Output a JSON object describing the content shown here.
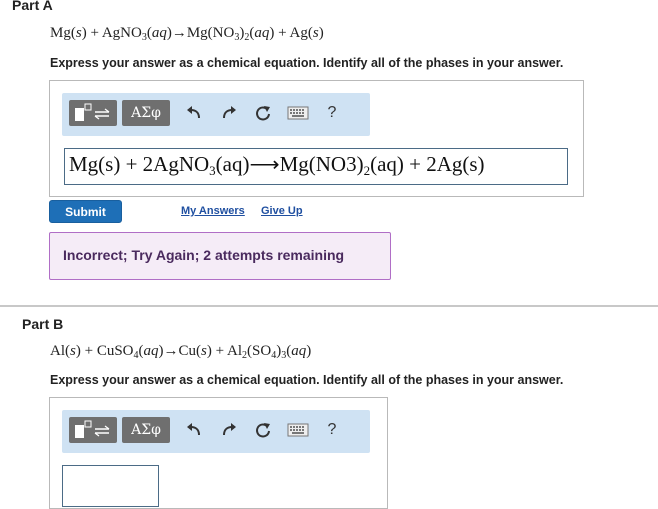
{
  "part_a": {
    "title": "Part A",
    "equation": {
      "r1": "Mg",
      "r1_phase": "s",
      "plus1": "+",
      "r2_a": "AgNO",
      "r2_sub": "3",
      "r2_phase": "aq",
      "arrow": "→",
      "p1_a": "Mg(NO",
      "p1_sub1": "3",
      "p1_close": ")",
      "p1_sub2": "2",
      "p1_phase": "aq",
      "plus2": "+",
      "p2": "Ag",
      "p2_phase": "s"
    },
    "instruction": "Express your answer as a chemical equation. Identify all of the phases in your answer.",
    "toolbar": {
      "symbols_label": "ΑΣφ",
      "help_label": "?"
    },
    "answer": {
      "part1": "Mg(s) + 2AgNO",
      "sub1": "3",
      "part2": "(aq)⟶Mg(NO3)",
      "sub2": "2",
      "part3": "(aq) + 2Ag(s)"
    },
    "submit_label": "Submit",
    "my_answers_label": "My Answers",
    "give_up_label": "Give Up",
    "feedback": "Incorrect; Try Again; 2 attempts remaining"
  },
  "part_b": {
    "title": "Part B",
    "equation": {
      "r1": "Al",
      "r1_phase": "s",
      "plus1": "+",
      "r2_a": "CuSO",
      "r2_sub": "4",
      "r2_phase": "aq",
      "arrow": "→",
      "p1": "Cu",
      "p1_phase": "s",
      "plus2": "+",
      "p2_a": "Al",
      "p2_sub1": "2",
      "p2_b": "(SO",
      "p2_sub2": "4",
      "p2_close": ")",
      "p2_sub3": "3",
      "p2_phase": "aq"
    },
    "instruction": "Express your answer as a chemical equation. Identify all of the phases in your answer.",
    "toolbar": {
      "symbols_label": "ΑΣφ",
      "help_label": "?"
    }
  },
  "colors": {
    "toolbar_bg": "#cfe2f3",
    "button_gray": "#6f6f6f",
    "submit_blue": "#1e6fb7",
    "link_blue": "#1f4fa0",
    "feedback_border": "#b06ec6",
    "feedback_bg": "#f5ecf7"
  },
  "icons": [
    "template-icon",
    "undo-icon",
    "redo-icon",
    "reset-icon",
    "keyboard-icon",
    "help-icon"
  ]
}
